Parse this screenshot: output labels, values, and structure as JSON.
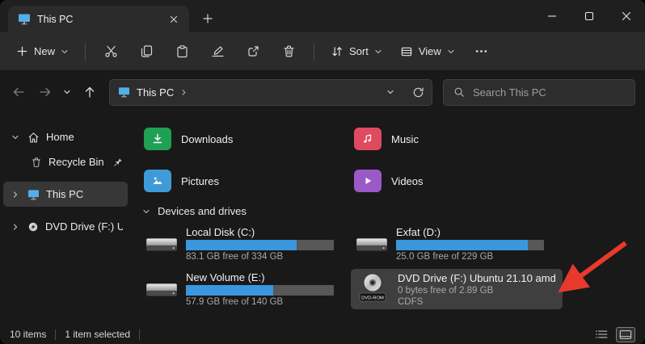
{
  "window": {
    "tab_title": "This PC"
  },
  "toolbar": {
    "new_label": "New",
    "sort_label": "Sort",
    "view_label": "View"
  },
  "address": {
    "breadcrumb": "This PC"
  },
  "search": {
    "placeholder": "Search This PC"
  },
  "sidebar": {
    "items": [
      {
        "label": "Home"
      },
      {
        "label": "Recycle Bin"
      },
      {
        "label": "This PC"
      },
      {
        "label": "DVD Drive (F:) Ubun"
      }
    ]
  },
  "content": {
    "folders": [
      {
        "name": "Downloads",
        "accent": "#1fa055"
      },
      {
        "name": "Music",
        "accent": "#e04a5f"
      },
      {
        "name": "Pictures",
        "accent": "#3f9bd8"
      },
      {
        "name": "Videos",
        "accent": "#9b59c7"
      }
    ],
    "section_label": "Devices and drives",
    "drives": [
      {
        "name": "Local Disk (C:)",
        "free": "83.1 GB free of 334 GB",
        "usage": "75%"
      },
      {
        "name": "Exfat (D:)",
        "free": "25.0 GB free of 229 GB",
        "usage": "89%"
      },
      {
        "name": "New Volume (E:)",
        "free": "57.9 GB free of 140 GB",
        "usage": "59%"
      },
      {
        "name": "DVD Drive (F:) Ubuntu 21.10 amd",
        "free": "0 bytes free of 2.89 GB",
        "filesystem": "CDFS",
        "badge": "DVD-ROM"
      }
    ]
  },
  "statusbar": {
    "item_count": "10 items",
    "selection": "1 item selected"
  },
  "colors": {
    "usage_bar": "#3a96dd",
    "selection_bg": "#3f3f3f",
    "arrow": "#e8392e"
  }
}
